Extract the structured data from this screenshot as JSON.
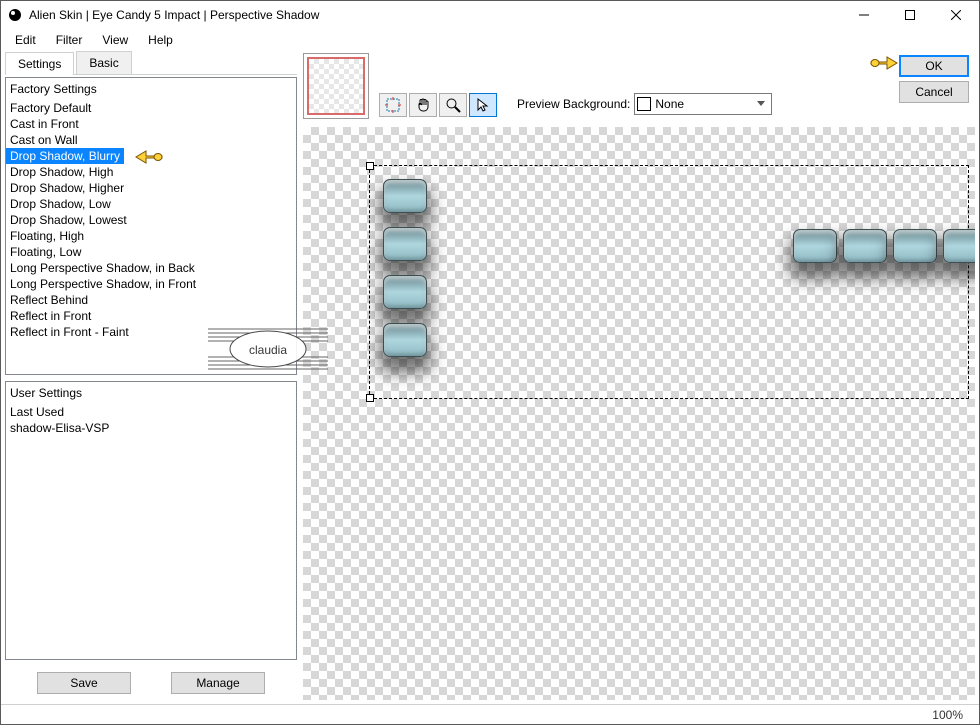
{
  "window": {
    "title": "Alien Skin | Eye Candy 5 Impact | Perspective Shadow"
  },
  "menu": {
    "items": [
      "Edit",
      "Filter",
      "View",
      "Help"
    ]
  },
  "tabs": {
    "settings": "Settings",
    "basic": "Basic"
  },
  "factory": {
    "header": "Factory Settings",
    "items": [
      "Factory Default",
      "Cast in Front",
      "Cast on Wall",
      "Drop Shadow, Blurry",
      "Drop Shadow, High",
      "Drop Shadow, Higher",
      "Drop Shadow, Low",
      "Drop Shadow, Lowest",
      "Floating, High",
      "Floating, Low",
      "Long Perspective Shadow, in Back",
      "Long Perspective Shadow, in Front",
      "Reflect Behind",
      "Reflect in Front",
      "Reflect in Front - Faint"
    ],
    "selected_index": 3
  },
  "user": {
    "header": "User Settings",
    "items": [
      "Last Used",
      "shadow-Elisa-VSP"
    ]
  },
  "buttons": {
    "save": "Save",
    "manage": "Manage",
    "ok": "OK",
    "cancel": "Cancel"
  },
  "preview": {
    "bg_label": "Preview Background:",
    "bg_value": "None"
  },
  "status": {
    "zoom": "100%"
  },
  "watermark": {
    "text": "claudia"
  }
}
